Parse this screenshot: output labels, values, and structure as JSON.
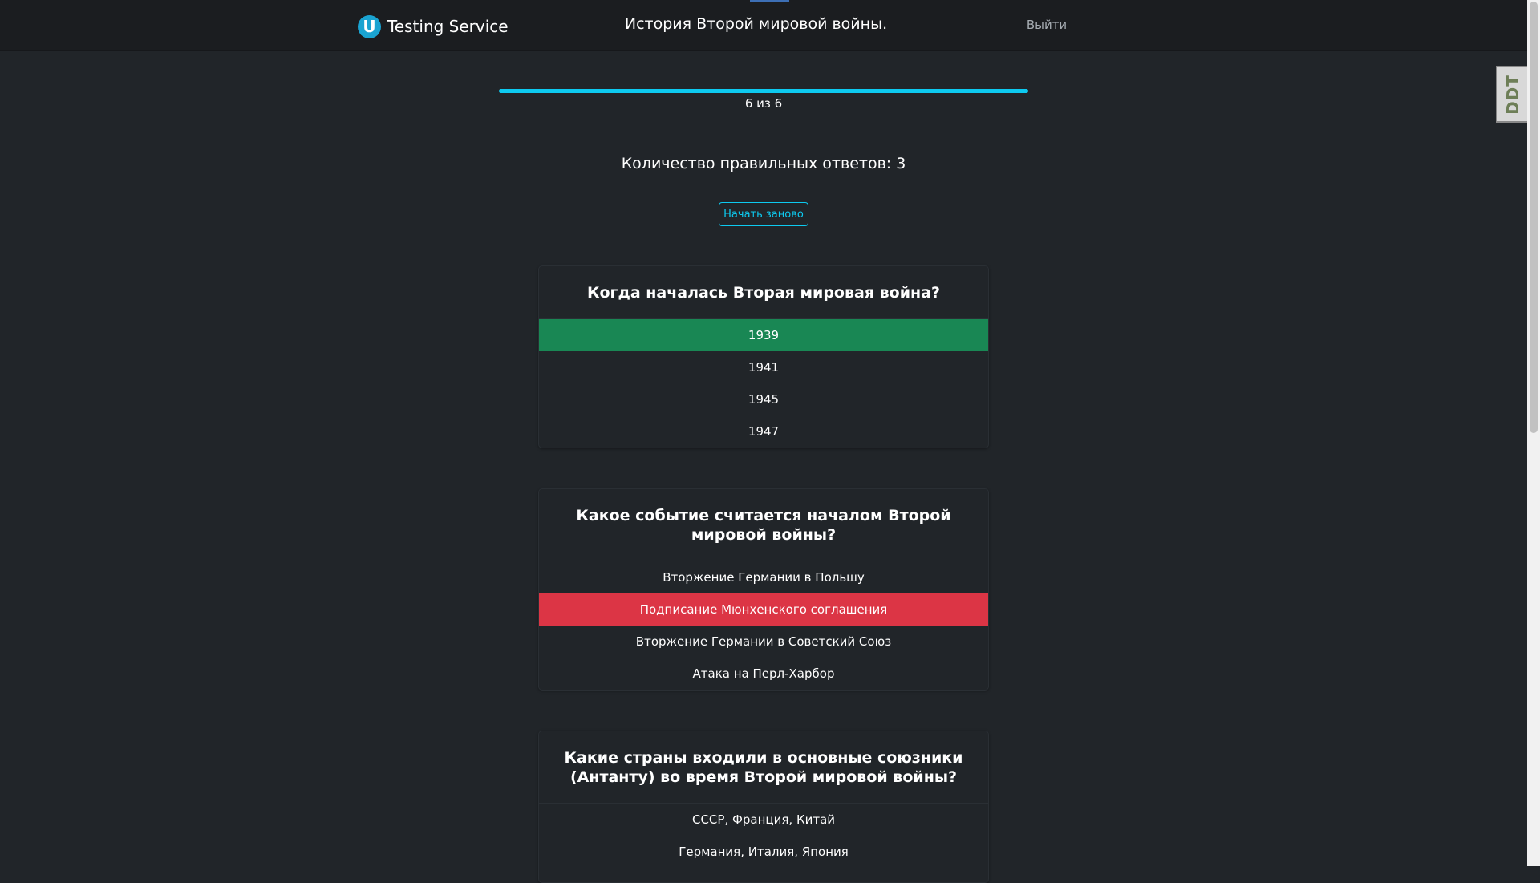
{
  "header": {
    "brand_logo_letter": "U",
    "brand_name": "Testing Service",
    "page_title": "История Второй мировой войны.",
    "logout_label": "Выйти"
  },
  "progress": {
    "current": 6,
    "total": 6,
    "label": "6 из 6",
    "accent": "#0dcaf0"
  },
  "result": {
    "score_text": "Количество правильных ответов: 3",
    "restart_label": "Начать заново"
  },
  "questions": [
    {
      "text": "Когда началась Вторая мировая война?",
      "answers": [
        {
          "text": "1939",
          "state": "correct"
        },
        {
          "text": "1941",
          "state": "none"
        },
        {
          "text": "1945",
          "state": "none"
        },
        {
          "text": "1947",
          "state": "none"
        }
      ]
    },
    {
      "text": "Какое событие считается началом Второй мировой войны?",
      "answers": [
        {
          "text": "Вторжение Германии в Польшу",
          "state": "none"
        },
        {
          "text": "Подписание Мюнхенского соглашения",
          "state": "wrong"
        },
        {
          "text": "Вторжение Германии в Советский Союз",
          "state": "none"
        },
        {
          "text": "Атака на Перл-Харбор",
          "state": "none"
        }
      ]
    },
    {
      "text": "Какие страны входили в основные союзники (Антанту) во время Второй мировой войны?",
      "answers": [
        {
          "text": "СССР, Франция, Китай",
          "state": "none"
        },
        {
          "text": "Германия, Италия, Япония",
          "state": "none"
        }
      ]
    }
  ],
  "colors": {
    "correct": "#198754",
    "wrong": "#dc3545",
    "background": "#212529"
  },
  "extension_widget": {
    "label": "DDT",
    "icon": "dark-reader-icon"
  }
}
